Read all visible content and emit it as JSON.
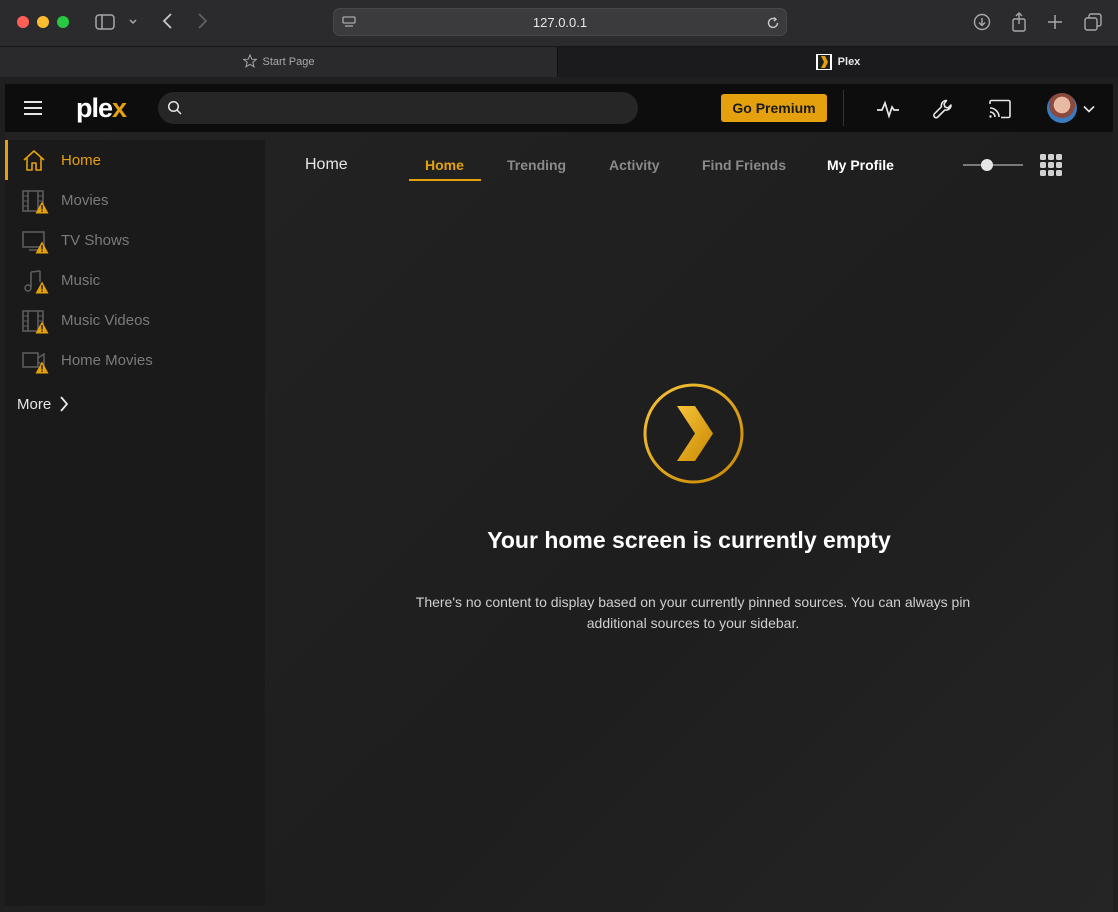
{
  "browser": {
    "url": "127.0.0.1",
    "tabs": [
      {
        "label": "Start Page",
        "active": false
      },
      {
        "label": "Plex",
        "active": true
      }
    ]
  },
  "header": {
    "logo_text": "ple",
    "logo_accent": "x",
    "search_placeholder": "",
    "premium_label": "Go Premium",
    "icons": [
      "hamburger-icon",
      "search-icon",
      "activity-icon",
      "wrench-icon",
      "cast-icon",
      "avatar",
      "chevron-down-icon"
    ]
  },
  "sidebar": {
    "items": [
      {
        "label": "Home",
        "icon": "home-icon",
        "active": true,
        "warning": false
      },
      {
        "label": "Movies",
        "icon": "film-icon",
        "active": false,
        "warning": true
      },
      {
        "label": "TV Shows",
        "icon": "tv-icon",
        "active": false,
        "warning": true
      },
      {
        "label": "Music",
        "icon": "music-icon",
        "active": false,
        "warning": true
      },
      {
        "label": "Music Videos",
        "icon": "film-icon",
        "active": false,
        "warning": true
      },
      {
        "label": "Home Movies",
        "icon": "camera-icon",
        "active": false,
        "warning": true
      }
    ],
    "more_label": "More"
  },
  "main": {
    "page_title": "Home",
    "tabs": [
      {
        "label": "Home",
        "active": true
      },
      {
        "label": "Trending",
        "active": false
      },
      {
        "label": "Activity",
        "active": false
      },
      {
        "label": "Find Friends",
        "active": false
      },
      {
        "label": "My Profile",
        "active": false
      }
    ],
    "empty_title": "Your home screen is currently empty",
    "empty_desc_line1": "There's no content to display based on your currently pinned sources. You can always pin",
    "empty_desc_line2": "additional sources to your sidebar."
  },
  "colors": {
    "accent": "#e5a00d",
    "background": "#1f1f1f",
    "topbar": "#0d0d0d"
  }
}
